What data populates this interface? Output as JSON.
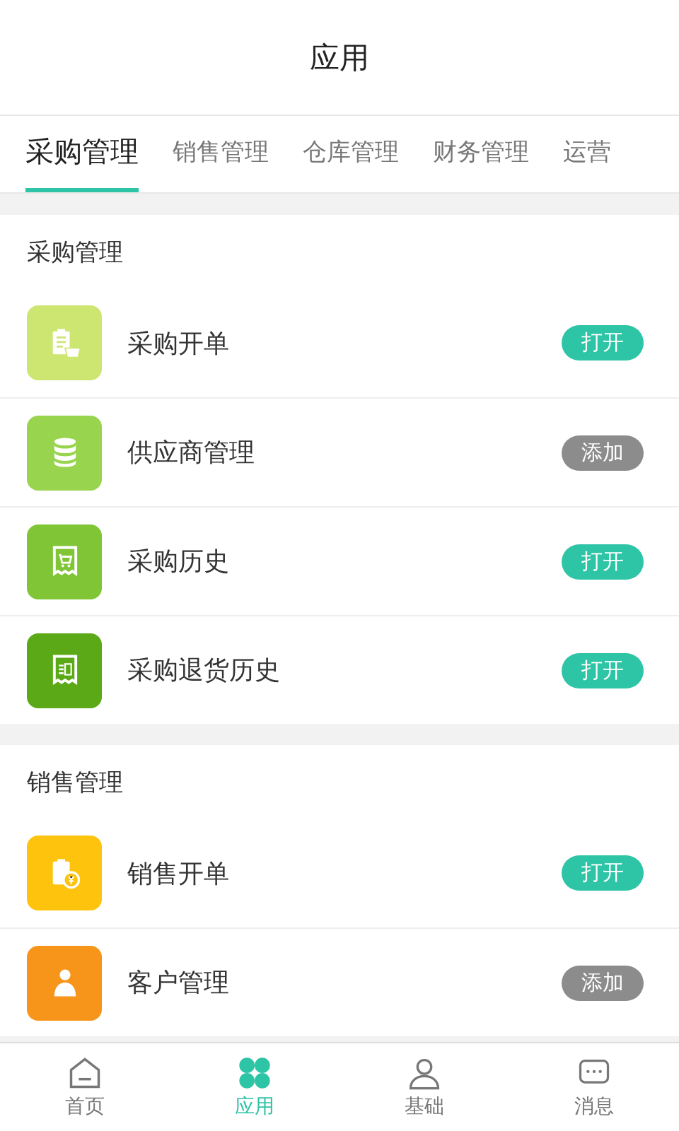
{
  "header": {
    "title": "应用"
  },
  "tabs": [
    {
      "label": "采购管理",
      "selected": true
    },
    {
      "label": "销售管理",
      "selected": false
    },
    {
      "label": "仓库管理",
      "selected": false
    },
    {
      "label": "财务管理",
      "selected": false
    },
    {
      "label": "运营",
      "selected": false
    }
  ],
  "sections": [
    {
      "title": "采购管理",
      "items": [
        {
          "name": "采购开单",
          "kind": "clipboard-basket",
          "color": "#cde672",
          "action": {
            "kind": "open",
            "label": "打开"
          }
        },
        {
          "name": "供应商管理",
          "kind": "database",
          "color": "#99d44e",
          "action": {
            "kind": "add",
            "label": "添加"
          }
        },
        {
          "name": "采购历史",
          "kind": "receipt-cart",
          "color": "#7fc535",
          "action": {
            "kind": "open",
            "label": "打开"
          }
        },
        {
          "name": "采购退货历史",
          "kind": "receipt-return",
          "color": "#5ba916",
          "action": {
            "kind": "open",
            "label": "打开"
          }
        }
      ]
    },
    {
      "title": "销售管理",
      "items": [
        {
          "name": "销售开单",
          "kind": "clipboard-coin",
          "color": "#fdc30d",
          "action": {
            "kind": "open",
            "label": "打开"
          }
        },
        {
          "name": "客户管理",
          "kind": "person",
          "color": "#f7951b",
          "action": {
            "kind": "add",
            "label": "添加"
          }
        }
      ]
    }
  ],
  "nav": [
    {
      "label": "首页",
      "kind": "home",
      "selected": false
    },
    {
      "label": "应用",
      "kind": "apps",
      "selected": true
    },
    {
      "label": "基础",
      "kind": "person",
      "selected": false
    },
    {
      "label": "消息",
      "kind": "message",
      "selected": false
    }
  ]
}
